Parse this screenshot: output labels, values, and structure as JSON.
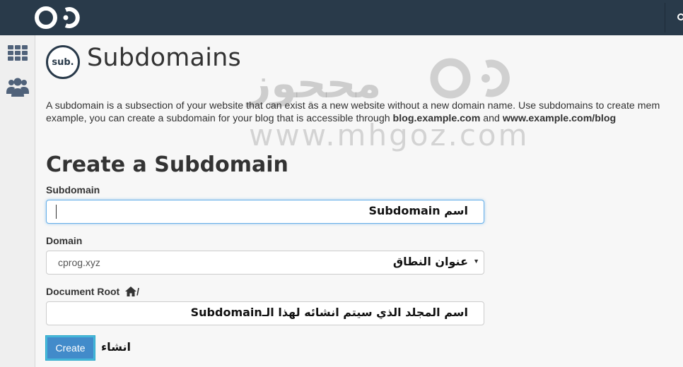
{
  "topbar": {
    "logo": "mhgoz-logo-icon",
    "search_icon": "search-icon"
  },
  "sidebar": {
    "items": [
      {
        "icon": "grid-apps-icon"
      },
      {
        "icon": "users-group-icon"
      }
    ]
  },
  "page": {
    "badge_text": "sub.",
    "title": "Subdomains",
    "description_part1": "A subdomain is a subsection of your website that can exist as a new website without a new domain name. Use subdomains to create mem",
    "description_part2": "example, you can create a subdomain for your blog that is accessible through ",
    "description_link1": "blog.example.com",
    "description_and": " and ",
    "description_link2": "www.example.com/blog"
  },
  "watermark": {
    "arabic": "محجوز",
    "url": "www.mhgoz.com"
  },
  "form": {
    "section_title": "Create a Subdomain",
    "subdomain_label": "Subdomain",
    "subdomain_value": "",
    "subdomain_note": "اسم Subdomain",
    "domain_label": "Domain",
    "domain_value": "cprog.xyz",
    "domain_note": "عنوان النطاق",
    "docroot_label": "Document Root",
    "docroot_slash": "/",
    "docroot_value": "",
    "docroot_note": "اسم المجلد الذي سيتم انشائه لهذا الـSubdomain",
    "create_label": "Create",
    "create_note": "انشاء"
  },
  "colors": {
    "topbar": "#293a4a",
    "primary": "#428bca",
    "focus": "#66afe9"
  }
}
